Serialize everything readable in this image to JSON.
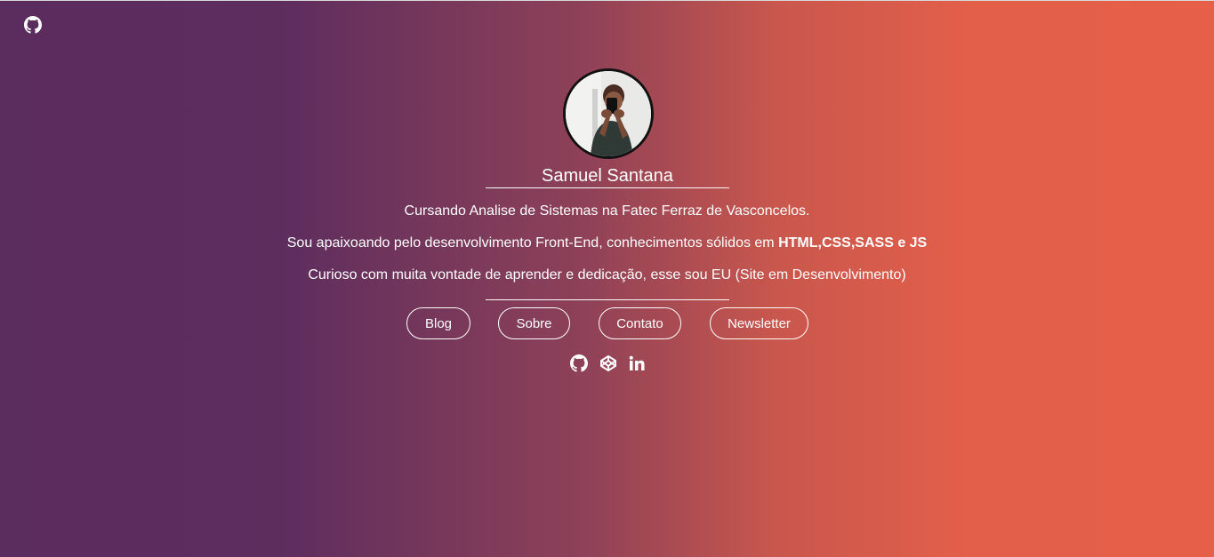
{
  "profile": {
    "name": "Samuel Santana",
    "line1": "Cursando Analise de Sistemas na Fatec Ferraz de Vasconcelos.",
    "line2_prefix": "Sou apaixoando pelo desenvolvimento Front-End, conhecimentos sólidos em ",
    "line2_bold": "HTML,CSS,SASS e JS",
    "line3": "Curioso com muita vontade de aprender e dedicação, esse sou EU (Site em Desenvolvimento)"
  },
  "nav": {
    "blog": "Blog",
    "sobre": "Sobre",
    "contato": "Contato",
    "newsletter": "Newsletter"
  },
  "icons": {
    "corner": "github-icon",
    "social": [
      "github-icon",
      "codepen-icon",
      "linkedin-icon"
    ]
  },
  "colors": {
    "gradient_start": "#5b2c5e",
    "gradient_end": "#e65f48",
    "text": "#ffffff"
  }
}
